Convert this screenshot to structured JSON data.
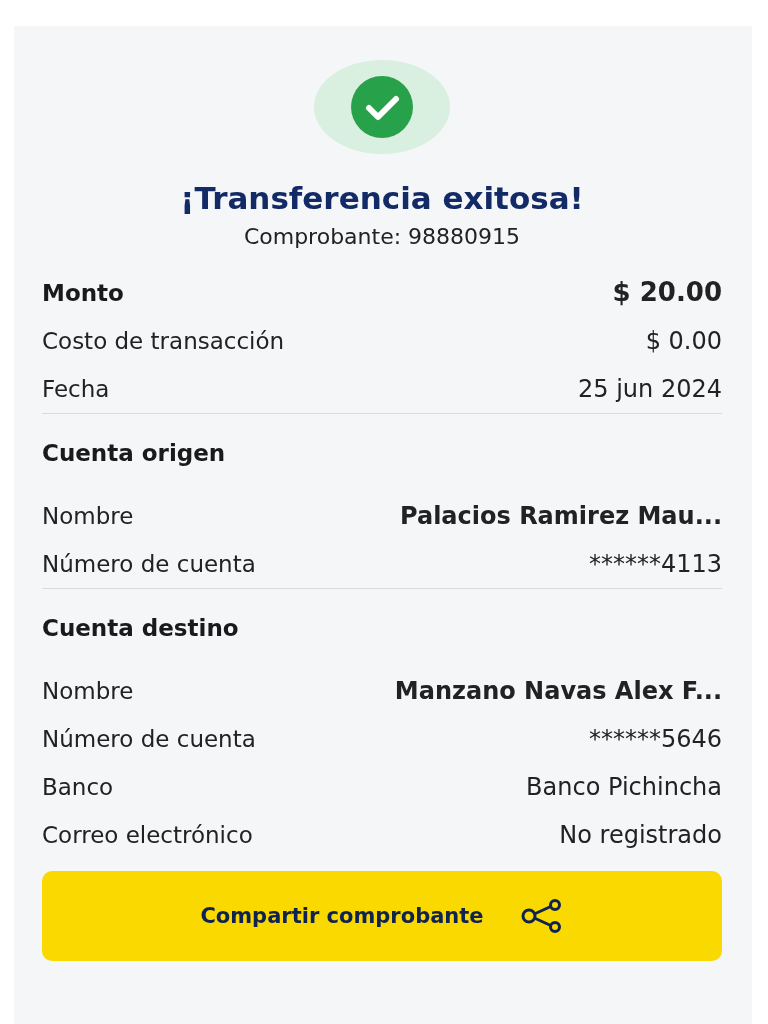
{
  "status": {
    "title": "¡Transferencia exitosa!",
    "receipt": "Comprobante: 98880915"
  },
  "sections": [
    {
      "heading": "Monto",
      "rows": [
        {
          "label": "Costo de transacción",
          "value": "$ 0.00",
          "bold": false
        },
        {
          "label": "Fecha",
          "value": "25 jun 2024",
          "bold": false
        }
      ],
      "heading_value": "$ 20.00"
    },
    {
      "heading": "Cuenta origen",
      "rows": [
        {
          "label": "Nombre",
          "value": "Palacios  Ramirez Mau...",
          "bold": true
        },
        {
          "label": "Número de cuenta",
          "value": "******4113",
          "bold": false
        }
      ]
    },
    {
      "heading": "Cuenta destino",
      "rows": [
        {
          "label": "Nombre",
          "value": "Manzano  Navas Alex F...",
          "bold": true
        },
        {
          "label": "Número de cuenta",
          "value": "******5646",
          "bold": false
        },
        {
          "label": "Banco",
          "value": "Banco Pichincha",
          "bold": false
        },
        {
          "label": "Correo electrónico",
          "value": "No registrado",
          "bold": false
        }
      ]
    }
  ],
  "share_button": {
    "label": "Compartir comprobante"
  }
}
